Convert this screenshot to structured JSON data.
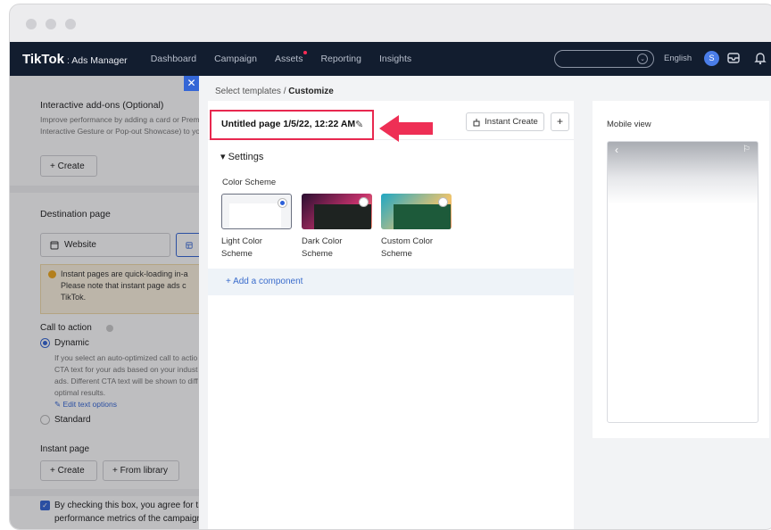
{
  "nav": {
    "logo": "TikTok",
    "logo_sub": ": Ads Manager",
    "items": [
      "Dashboard",
      "Campaign",
      "Assets",
      "Reporting",
      "Insights"
    ],
    "language": "English",
    "avatar_initial": "S"
  },
  "left_panel": {
    "addons_title": "Interactive add-ons (Optional)",
    "addons_desc_1": "Improve performance by adding a card or Prem",
    "addons_desc_2": "Interactive Gesture or Pop-out Showcase) to yo",
    "create_label": "+ Create",
    "destination_title": "Destination page",
    "website_label": "Website",
    "notice_1": "Instant pages are quick-loading in-a",
    "notice_2": "Please note that instant page ads c",
    "notice_3": "TikTok.",
    "cta_title": "Call to action",
    "dynamic_label": "Dynamic",
    "dynamic_desc_1": "If you select an auto-optimized call to actio",
    "dynamic_desc_2": "CTA text for your ads based on your indust",
    "dynamic_desc_3": "ads. Different CTA text will be shown to diff",
    "dynamic_desc_4": "optimal results.",
    "edit_text_options": "Edit text options",
    "standard_label": "Standard",
    "instant_page_title": "Instant page",
    "create_btn": "+ Create",
    "from_library_btn": "+ From library",
    "agree_1": "By checking this box, you agree for the",
    "agree_2": "performance metrics of the campaign"
  },
  "modal": {
    "breadcrumb_parent": "Select templates",
    "breadcrumb_sep": "/",
    "breadcrumb_current": "Customize",
    "page_title": "Untitled page 1/5/22, 12:22 AM",
    "instant_create": "Instant Create",
    "plus": "+",
    "settings": "Settings",
    "color_scheme_label": "Color Scheme",
    "schemes": [
      {
        "line1": "Light Color",
        "line2": "Scheme",
        "selected": true
      },
      {
        "line1": "Dark Color",
        "line2": "Scheme",
        "selected": false
      },
      {
        "line1": "Custom Color",
        "line2": "Scheme",
        "selected": false
      }
    ],
    "add_component": "+   Add a component",
    "mobile_view": "Mobile view"
  },
  "colors": {
    "nav_bg": "#121d2f",
    "highlight": "#e8284f",
    "accent_blue": "#3466d6"
  }
}
